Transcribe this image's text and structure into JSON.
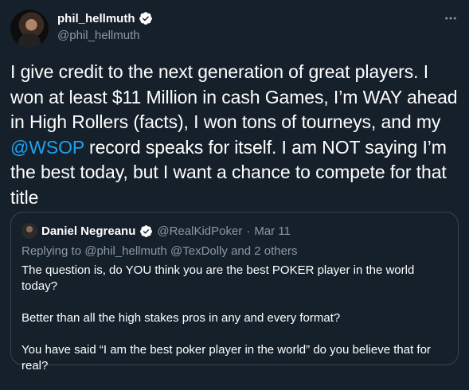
{
  "tweet": {
    "display_name": "phil_hellmuth",
    "handle": "@phil_hellmuth",
    "text_part1": "I give credit to the next generation of great players. I won at least $11 Million in cash Games, I’m WAY ahead in High Rollers (facts), I won tons of tourneys, and my ",
    "mention": "@WSOP",
    "text_part2": " record speaks for itself. I am NOT saying I’m the best today, but I want a chance to compete for that title"
  },
  "quote": {
    "display_name": "Daniel Negreanu",
    "handle": "@RealKidPoker",
    "separator": "·",
    "date": "Mar 11",
    "replying_to": "Replying to @phil_hellmuth @TexDolly and 2 others",
    "paragraphs": [
      "The question is, do YOU think you are the best POKER player in the world today?",
      "Better than all the high stakes pros in any and every format?",
      "You have said “I am the best poker player in the world” do you believe that for real?"
    ]
  },
  "colors": {
    "background": "#15202b",
    "accent": "#1da1f2",
    "secondary_text": "#8899a6",
    "border": "#38444d"
  },
  "icons": {
    "verified": "verified-badge-icon",
    "more": "more-options-icon"
  }
}
